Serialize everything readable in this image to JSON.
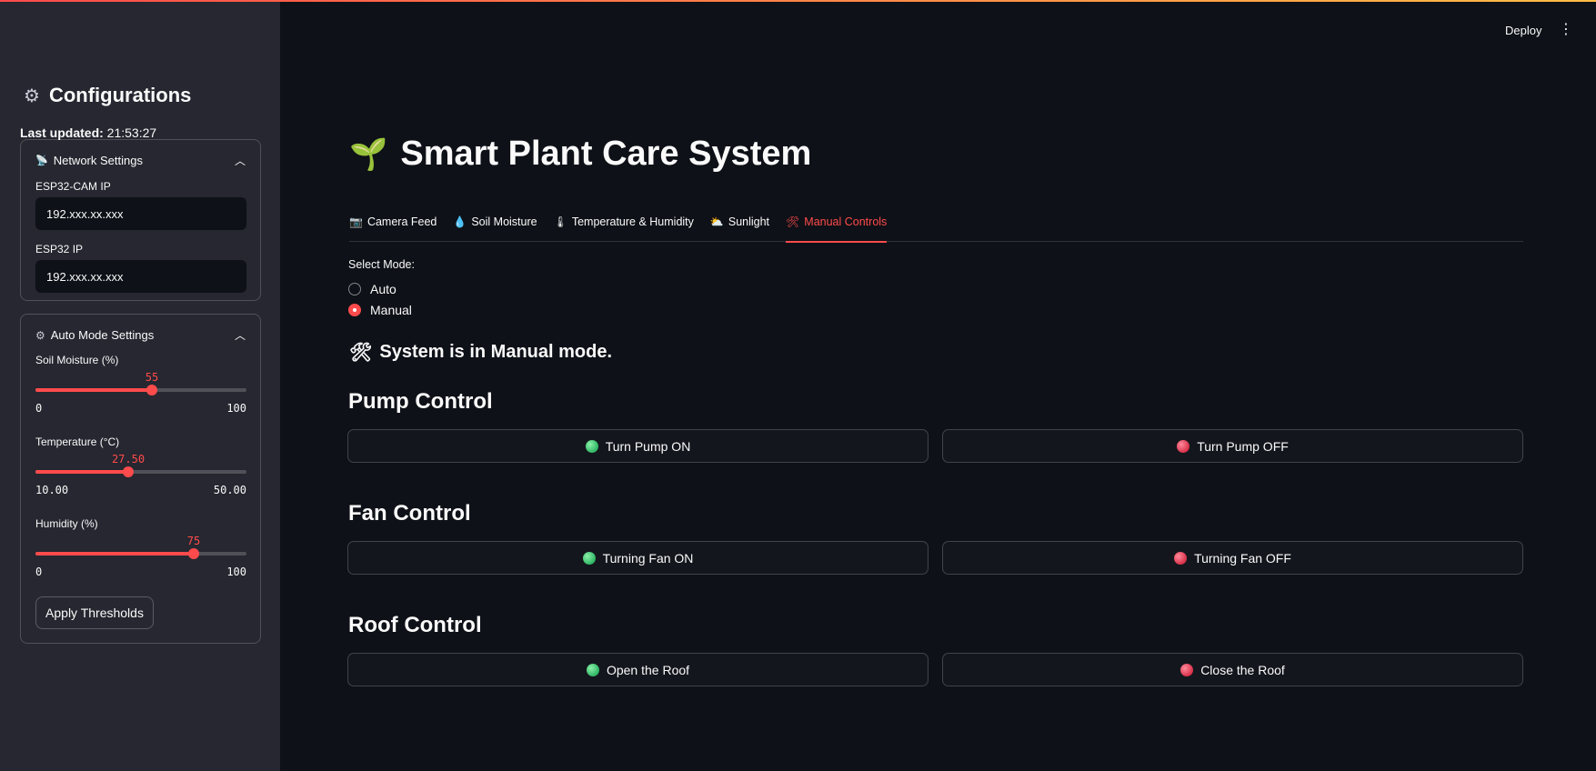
{
  "sidebar": {
    "title": "Configurations",
    "title_icon": "gear-icon",
    "updated_label": "Last updated:",
    "updated_time": "21:53:27",
    "network": {
      "header": "Network Settings",
      "esp32cam_label": "ESP32-CAM IP",
      "esp32cam_value": "192.xxx.xx.xxx",
      "esp32_label": "ESP32 IP",
      "esp32_value": "192.xxx.xx.xxx"
    },
    "auto": {
      "header": "Auto Mode Settings",
      "soil": {
        "label": "Soil Moisture (%)",
        "value": "55",
        "min": "0",
        "max": "100",
        "fraction": 0.55
      },
      "temp": {
        "label": "Temperature (°C)",
        "value": "27.50",
        "min": "10.00",
        "max": "50.00",
        "fraction": 0.4375
      },
      "humidity": {
        "label": "Humidity (%)",
        "value": "75",
        "min": "0",
        "max": "100",
        "fraction": 0.75
      },
      "apply_label": "Apply Thresholds"
    }
  },
  "header": {
    "deploy_label": "Deploy",
    "menu_icon": "kebab-menu-icon"
  },
  "main": {
    "title": "Smart Plant Care System",
    "title_icon": "seedling-icon",
    "tabs": [
      {
        "label": "Camera Feed",
        "icon": "camera-icon"
      },
      {
        "label": "Soil Moisture",
        "icon": "droplet-icon"
      },
      {
        "label": "Temperature & Humidity",
        "icon": "thermometer-icon"
      },
      {
        "label": "Sunlight",
        "icon": "sun-cloud-icon"
      },
      {
        "label": "Manual Controls",
        "icon": "tools-icon",
        "active": true
      }
    ],
    "mode_label": "Select Mode:",
    "modes": [
      "Auto",
      "Manual"
    ],
    "selected_mode": "Manual",
    "status": "System is in Manual mode.",
    "pump": {
      "heading": "Pump Control",
      "on": "Turn Pump ON",
      "off": "Turn Pump OFF"
    },
    "fan": {
      "heading": "Fan Control",
      "on": "Turning Fan ON",
      "off": "Turning Fan OFF"
    },
    "roof": {
      "heading": "Roof Control",
      "on": "Open the Roof",
      "off": "Close the Roof"
    }
  },
  "colors": {
    "accent": "#ff4b4b",
    "background": "#0e1117",
    "sidebar": "#262730",
    "on": "#2fb564",
    "off": "#d9304a"
  }
}
